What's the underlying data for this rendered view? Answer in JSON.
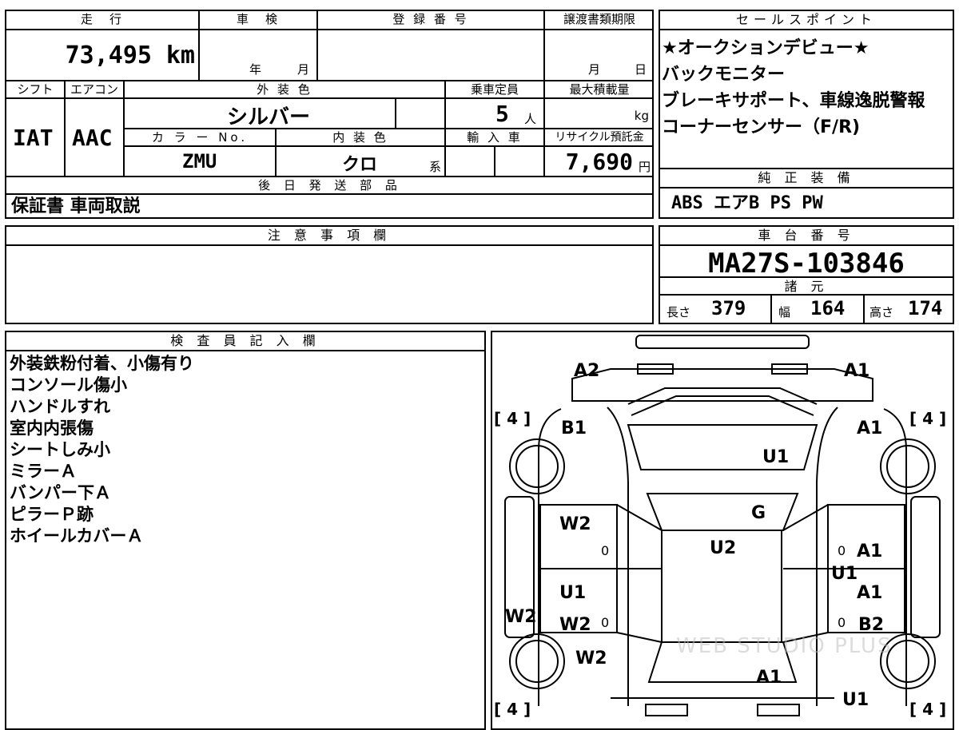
{
  "top_headers": {
    "mileage": "走　行",
    "inspection": "車　検",
    "registration": "登 録 番 号",
    "transfer_deadline": "譲渡書類期限",
    "sales_points": "セールスポイント"
  },
  "mileage_value": "73,495",
  "mileage_unit": "km",
  "inspection_year": "年",
  "inspection_month": "月",
  "transfer_month": "月",
  "transfer_day": "日",
  "row2_headers": {
    "shift": "シフト",
    "aircon": "エアコン",
    "exterior_color": "外 装 色",
    "capacity": "乗車定員",
    "max_load": "最大積載量"
  },
  "shift_value": "IAT",
  "aircon_value": "AAC",
  "exterior_color_value": "シルバー",
  "capacity_value": "5",
  "capacity_unit": "人",
  "max_load_unit": "kg",
  "row3_headers": {
    "color_no": "カ ラ ー No.",
    "interior_color": "内 装 色",
    "import": "輸 入 車",
    "recycle_fee": "リサイクル預託金"
  },
  "color_no_value": "ZMU",
  "interior_color_value": "クロ",
  "interior_color_suffix": "系",
  "recycle_fee_value": "7,690",
  "recycle_fee_unit": "円",
  "sales_points": [
    "★オークションデビュー★",
    "バックモニター",
    "ブレーキサポート、車線逸脱警報",
    "コーナーセンサー（F/R)"
  ],
  "later_parts_header": "後 日 発 送 部 品",
  "later_parts_value": "保証書 車両取説",
  "genuine_equipment_header": "純 正 装 備",
  "genuine_equipment_value": "ABS エアB PS PW",
  "notes_header": "注 意 事 項 欄",
  "chassis_header": "車 台 番 号",
  "chassis_value": "MA27S-103846",
  "specs_header": "諸 元",
  "specs": {
    "length_label": "長さ",
    "length_value": "379",
    "width_label": "幅",
    "width_value": "164",
    "height_label": "高さ",
    "height_value": "174"
  },
  "inspector_header": "検 査 員 記 入 欄",
  "inspector_notes": [
    "外装鉄粉付着、小傷有り",
    "コンソール傷小",
    "ハンドルすれ",
    "室内内張傷",
    "シートしみ小",
    "ミラーＡ",
    "バンパー下Ａ",
    "ピラーＰ跡",
    "ホイールカバーＡ"
  ],
  "diagram": {
    "tire_labels": [
      "[ 4 ]",
      "[ 4 ]",
      "[ 4 ]",
      "[ 4 ]"
    ],
    "marks": [
      "A2",
      "A1",
      "B1",
      "A1",
      "U1",
      "G",
      "W2",
      "U2",
      "A1",
      "U1",
      "U1",
      "A1",
      "W2",
      "W2",
      "B2",
      "W2",
      "A1",
      "U1"
    ],
    "zeros": [
      "0",
      "0",
      "0",
      "0"
    ],
    "watermark": "WEB STUDIO PLUS"
  }
}
